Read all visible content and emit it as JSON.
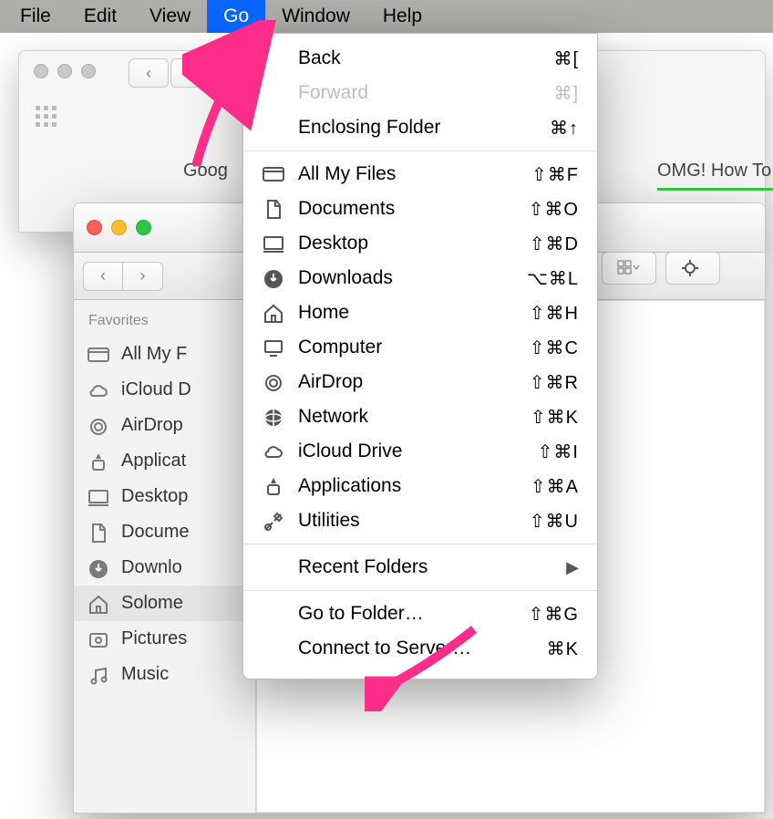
{
  "menubar": {
    "items": [
      "File",
      "Edit",
      "View",
      "Go",
      "Window",
      "Help"
    ],
    "active_index": 3
  },
  "browser": {
    "tab1_partial": "Goog",
    "tab2_partial": "OMG! How To"
  },
  "finder": {
    "sidebar_header": "Favorites",
    "sidebar_items": [
      {
        "icon": "allfiles",
        "label": "All My F"
      },
      {
        "icon": "cloud",
        "label": "iCloud D"
      },
      {
        "icon": "airdrop",
        "label": "AirDrop"
      },
      {
        "icon": "apps",
        "label": "Applicat"
      },
      {
        "icon": "desktop",
        "label": "Desktop"
      },
      {
        "icon": "docs",
        "label": "Docume"
      },
      {
        "icon": "downloads",
        "label": "Downlo"
      },
      {
        "icon": "home",
        "label": "Solome",
        "selected": true
      },
      {
        "icon": "pictures",
        "label": "Pictures"
      },
      {
        "icon": "music",
        "label": "Music"
      }
    ]
  },
  "go_menu": {
    "sections": [
      [
        {
          "label": "Back",
          "shortcut": "⌘[",
          "icon": ""
        },
        {
          "label": "Forward",
          "shortcut": "⌘]",
          "icon": "",
          "disabled": true
        },
        {
          "label": "Enclosing Folder",
          "shortcut": "⌘↑",
          "icon": ""
        }
      ],
      [
        {
          "label": "All My Files",
          "shortcut": "⇧⌘F",
          "icon": "allfiles"
        },
        {
          "label": "Documents",
          "shortcut": "⇧⌘O",
          "icon": "docs"
        },
        {
          "label": "Desktop",
          "shortcut": "⇧⌘D",
          "icon": "desktop"
        },
        {
          "label": "Downloads",
          "shortcut": "⌥⌘L",
          "icon": "downloads"
        },
        {
          "label": "Home",
          "shortcut": "⇧⌘H",
          "icon": "home"
        },
        {
          "label": "Computer",
          "shortcut": "⇧⌘C",
          "icon": "computer"
        },
        {
          "label": "AirDrop",
          "shortcut": "⇧⌘R",
          "icon": "airdrop"
        },
        {
          "label": "Network",
          "shortcut": "⇧⌘K",
          "icon": "network"
        },
        {
          "label": "iCloud Drive",
          "shortcut": "⇧⌘I",
          "icon": "cloud"
        },
        {
          "label": "Applications",
          "shortcut": "⇧⌘A",
          "icon": "apps"
        },
        {
          "label": "Utilities",
          "shortcut": "⇧⌘U",
          "icon": "utilities"
        }
      ],
      [
        {
          "label": "Recent Folders",
          "submenu": true
        }
      ],
      [
        {
          "label": "Go to Folder…",
          "shortcut": "⇧⌘G"
        },
        {
          "label": "Connect to Server…",
          "shortcut": "⌘K"
        }
      ]
    ]
  },
  "annotation": {
    "color": "#ff2d8a"
  }
}
